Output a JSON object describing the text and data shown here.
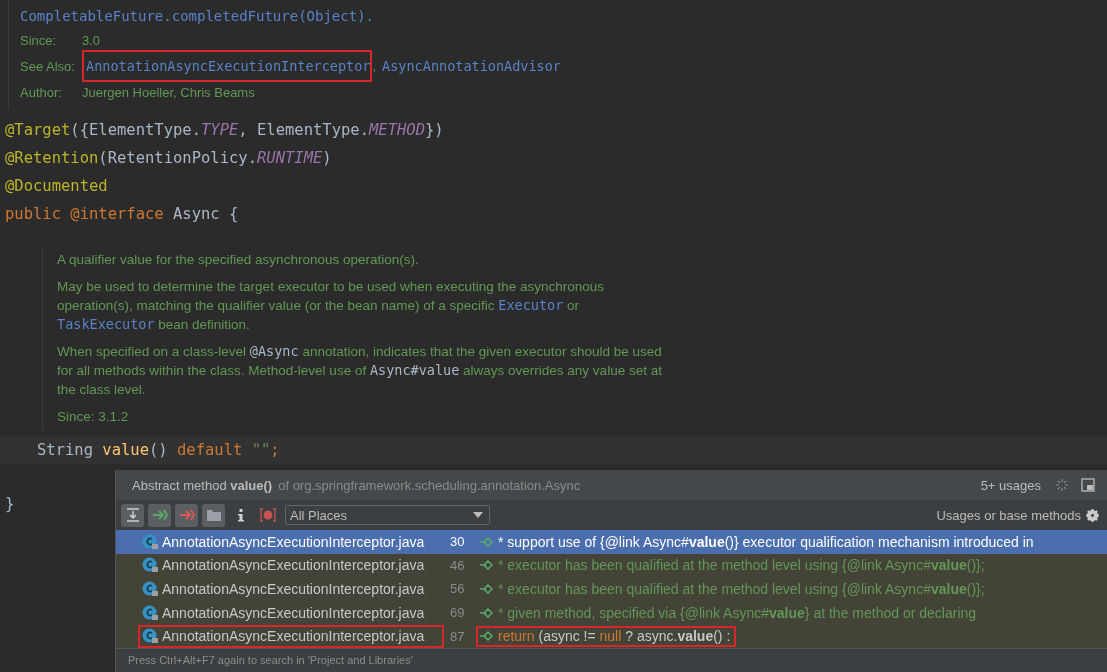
{
  "top_doc": {
    "code_line": "CompletableFuture.completedFuture(Object).",
    "fields": [
      {
        "label": "Since:",
        "values": [
          {
            "text": "3.0",
            "kind": "text"
          }
        ]
      },
      {
        "label": "See Also:",
        "values": [
          {
            "text": "AnnotationAsyncExecutionInterceptor",
            "kind": "link",
            "highlighted": true
          },
          {
            "text": ",",
            "kind": "text"
          },
          {
            "text": "AsyncAnnotationAdvisor",
            "kind": "link",
            "highlighted": false
          }
        ]
      },
      {
        "label": "Author:",
        "values": [
          {
            "text": "Juergen Hoeller, Chris Beams",
            "kind": "text"
          }
        ]
      }
    ]
  },
  "code_lines": [
    [
      {
        "t": "@Target",
        "kind": "annotation"
      },
      {
        "t": "({ElementType.",
        "kind": "plain"
      },
      {
        "t": "TYPE",
        "kind": "constant"
      },
      {
        "t": ", ElementType.",
        "kind": "plain"
      },
      {
        "t": "METHOD",
        "kind": "constant"
      },
      {
        "t": "})",
        "kind": "plain"
      }
    ],
    [
      {
        "t": "@Retention",
        "kind": "annotation"
      },
      {
        "t": "(RetentionPolicy.",
        "kind": "plain"
      },
      {
        "t": "RUNTIME",
        "kind": "constant"
      },
      {
        "t": ")",
        "kind": "plain"
      }
    ],
    [
      {
        "t": "@Documented",
        "kind": "annotation"
      }
    ],
    [
      {
        "t": "public @interface ",
        "kind": "keyword"
      },
      {
        "t": "Async {",
        "kind": "plain"
      }
    ]
  ],
  "member_doc": [
    [
      {
        "t": "A qualifier value for the specified asynchronous operation(s).",
        "kind": "text"
      }
    ],
    [
      {
        "t": "May be used to determine the target executor to be used when executing the asynchronous operation(s), matching the qualifier value (or the bean name) of a specific ",
        "kind": "text"
      },
      {
        "t": "Executor",
        "kind": "link"
      },
      {
        "t": " or ",
        "kind": "text"
      },
      {
        "t": "TaskExecutor",
        "kind": "link"
      },
      {
        "t": " bean definition.",
        "kind": "text"
      }
    ],
    [
      {
        "t": "When specified on a class-level ",
        "kind": "text"
      },
      {
        "t": "@Async",
        "kind": "code"
      },
      {
        "t": " annotation, indicates that the given executor should be used for all methods within the class. Method-level use of ",
        "kind": "text"
      },
      {
        "t": "Async#value",
        "kind": "code"
      },
      {
        "t": " always overrides any value set at the class level.",
        "kind": "text"
      }
    ],
    [
      {
        "t": "Since: 3.1.2",
        "kind": "text"
      }
    ]
  ],
  "member_line": [
    {
      "t": "String ",
      "kind": "plain"
    },
    {
      "t": "value",
      "kind": "method"
    },
    {
      "t": "() ",
      "kind": "plain"
    },
    {
      "t": "default ",
      "kind": "keyword"
    },
    {
      "t": "\"\"",
      "kind": "string"
    },
    {
      "t": ";",
      "kind": "keyword"
    }
  ],
  "closing_line": [
    {
      "t": "}",
      "kind": "plain"
    }
  ],
  "popup": {
    "title": "Abstract method **value()**",
    "qualifier": "of org.springframework.scheduling.annotation.Async",
    "count": "5+ usages",
    "tools": [
      {
        "kind": "expand",
        "pressed": true
      },
      {
        "kind": "next",
        "pressed": true
      },
      {
        "kind": "prev",
        "pressed": true
      },
      {
        "kind": "folder",
        "pressed": true
      },
      {
        "kind": "info",
        "pressed": false
      },
      {
        "kind": "method",
        "pressed": false
      }
    ],
    "scope": "All Places",
    "filter": "Usages or base methods",
    "rows": [
      {
        "file": "AnnotationAsyncExecutionInterceptor.java",
        "line": "30",
        "selected": true,
        "highlighted": false,
        "code": [
          {
            "t": "* support use of {@link Async#",
            "kind": "comment"
          },
          {
            "t": "value",
            "kind": "bold"
          },
          {
            "t": "()} executor qualification mechanism introduced in",
            "kind": "comment"
          }
        ]
      },
      {
        "file": "AnnotationAsyncExecutionInterceptor.java",
        "line": "46",
        "selected": false,
        "highlighted": false,
        "code": [
          {
            "t": "* executor has been qualified at the method level using {@link Async#",
            "kind": "comment"
          },
          {
            "t": "value",
            "kind": "bold"
          },
          {
            "t": "()};",
            "kind": "comment"
          }
        ]
      },
      {
        "file": "AnnotationAsyncExecutionInterceptor.java",
        "line": "56",
        "selected": false,
        "highlighted": false,
        "code": [
          {
            "t": "* executor has been qualified at the method level using {@link Async#",
            "kind": "comment"
          },
          {
            "t": "value",
            "kind": "bold"
          },
          {
            "t": "()};",
            "kind": "comment"
          }
        ]
      },
      {
        "file": "AnnotationAsyncExecutionInterceptor.java",
        "line": "69",
        "selected": false,
        "highlighted": false,
        "code": [
          {
            "t": "* given method, specified via {@link Async#",
            "kind": "comment"
          },
          {
            "t": "value",
            "kind": "bold"
          },
          {
            "t": "} at the method or declaring",
            "kind": "comment"
          }
        ]
      },
      {
        "file": "AnnotationAsyncExecutionInterceptor.java",
        "line": "87",
        "selected": false,
        "highlighted": true,
        "code": [
          {
            "t": "return",
            "kind": "keyword"
          },
          {
            "t": " (async != ",
            "kind": "plain"
          },
          {
            "t": "null",
            "kind": "keyword"
          },
          {
            "t": " ? async.",
            "kind": "plain"
          },
          {
            "t": "value",
            "kind": "plainbold"
          },
          {
            "t": "() :",
            "kind": "plain"
          }
        ]
      }
    ],
    "hint": "Press Ctrl+Alt+F7 again to search in 'Project and Libraries'"
  }
}
